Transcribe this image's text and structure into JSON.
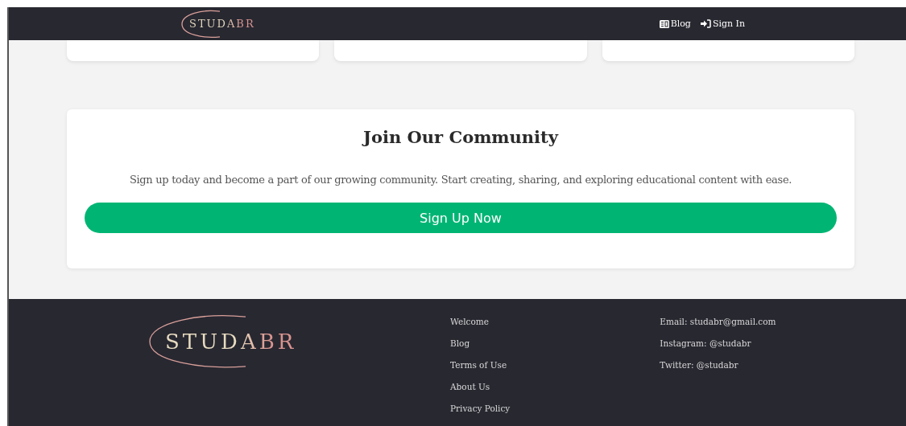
{
  "header": {
    "logo": "STUDABR",
    "nav": [
      {
        "label": "Blog",
        "kind": "news"
      },
      {
        "label": "Sign In",
        "kind": "signin"
      }
    ]
  },
  "community": {
    "title": "Join Our Community",
    "text": "Sign up today and become a part of our growing community. Start creating, sharing, and exploring educational content with ease.",
    "button": "Sign Up Now"
  },
  "footer": {
    "logo": "STUDABR",
    "links": [
      "Welcome",
      "Blog",
      "Terms of Use",
      "About Us",
      "Privacy Policy"
    ],
    "contacts": [
      "Email: studabr@gmail.com",
      "Instagram: @studabr",
      "Twitter: @studabr"
    ]
  }
}
